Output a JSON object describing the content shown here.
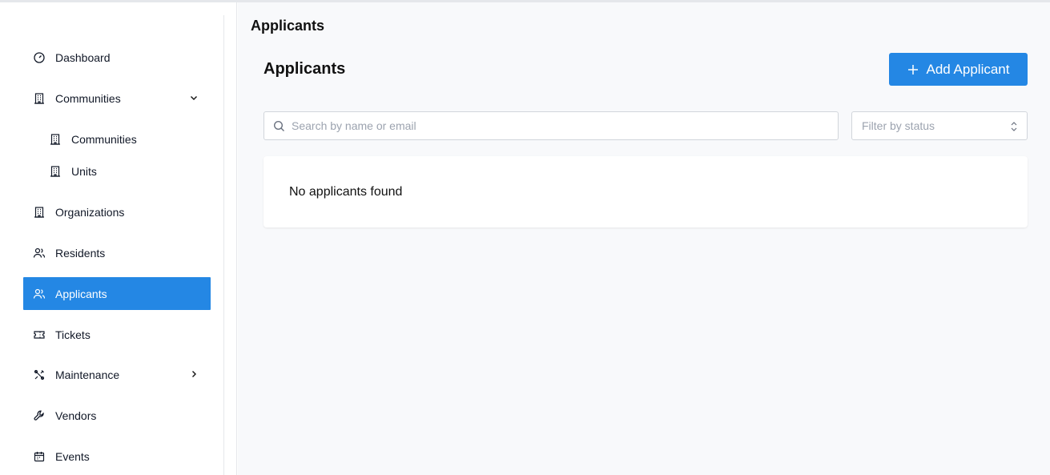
{
  "sidebar": {
    "items": [
      {
        "label": "Dashboard",
        "icon": "gauge-icon"
      },
      {
        "label": "Communities",
        "icon": "building-icon",
        "chevron": "chevron-down-icon"
      },
      {
        "label": "Communities",
        "icon": "building-icon",
        "sub": true
      },
      {
        "label": "Units",
        "icon": "building-icon",
        "sub": true
      },
      {
        "label": "Organizations",
        "icon": "building-icon"
      },
      {
        "label": "Residents",
        "icon": "users-icon"
      },
      {
        "label": "Applicants",
        "icon": "users-icon",
        "active": true
      },
      {
        "label": "Tickets",
        "icon": "ticket-icon"
      },
      {
        "label": "Maintenance",
        "icon": "tools-icon",
        "chevron": "chevron-right-icon"
      },
      {
        "label": "Vendors",
        "icon": "wrench-icon"
      },
      {
        "label": "Events",
        "icon": "calendar-icon"
      }
    ]
  },
  "header": {
    "breadcrumb_title": "Applicants"
  },
  "main": {
    "title": "Applicants",
    "add_button_label": "Add Applicant",
    "search_placeholder": "Search by name or email",
    "filter_placeholder": "Filter by status",
    "empty_message": "No applicants found"
  },
  "colors": {
    "accent": "#2487e4",
    "background": "#f8f9fb"
  }
}
